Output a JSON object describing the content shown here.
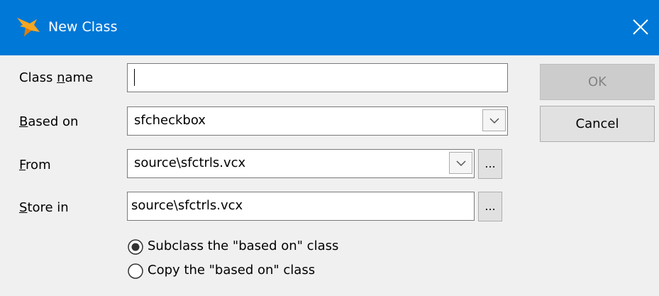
{
  "window": {
    "title": "New Class",
    "icon": "fox-icon",
    "close_icon": "close-icon"
  },
  "form": {
    "class_name": {
      "label_prefix": "Class ",
      "label_underlined": "n",
      "label_suffix": "ame",
      "value": ""
    },
    "based_on": {
      "label_prefix": "",
      "label_underlined": "B",
      "label_suffix": "ased on",
      "value": "sfcheckbox"
    },
    "from": {
      "label_prefix": "",
      "label_underlined": "F",
      "label_suffix": "rom",
      "value": "source\\sfctrls.vcx",
      "browse_label": "..."
    },
    "store_in": {
      "label_prefix": "",
      "label_underlined": "S",
      "label_suffix": "tore in",
      "value": "source\\sfctrls.vcx",
      "browse_label": "..."
    }
  },
  "options": {
    "subclass": {
      "label": "Subclass the \"based on\" class",
      "selected": true
    },
    "copy": {
      "label": "Copy the \"based on\" class",
      "selected": false
    }
  },
  "buttons": {
    "ok": "OK",
    "cancel": "Cancel"
  },
  "colors": {
    "titlebar": "#0078d7",
    "background": "#f0f0f0"
  }
}
